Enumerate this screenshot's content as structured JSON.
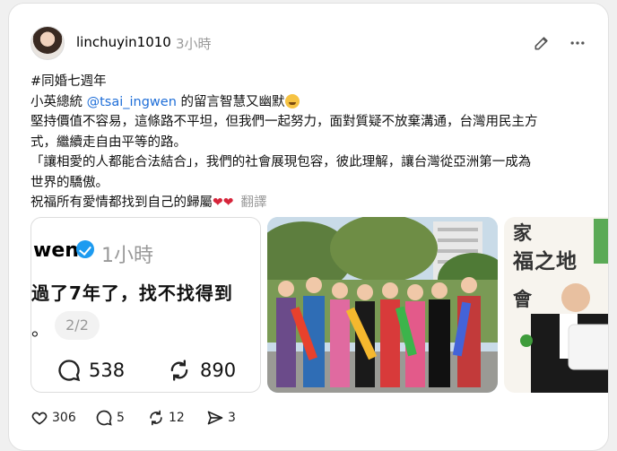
{
  "post": {
    "username": "linchuyin1010",
    "timestamp": "3小時",
    "hashtag": "#同婚七週年",
    "line2_pre": "小英總統 ",
    "mention": "@tsai_ingwen",
    "line2_post": " 的留言智慧又幽默",
    "line3": "堅持價值不容易，這條路不平坦，但我們一起努力，面對質疑不放棄溝通，台灣用民主方",
    "line4": "式，繼續走自由平等的路。",
    "line5": "「讓相愛的人都能合法結合」，我們的社會展現包容，彼此理解，讓台灣從亞洲第一成為",
    "line6": "世界的驕傲。",
    "line7": "祝福所有愛情都找到自己的歸屬",
    "translate": "翻譯"
  },
  "quote": {
    "name": "wen",
    "time": "1小時",
    "text": "過了7年了，找不找得到",
    "dot": "。",
    "page": "2/2",
    "replies": "538",
    "reposts": "890"
  },
  "photo3": {
    "line1": "家",
    "line2": "福之地",
    "line3": "會"
  },
  "actions": {
    "likes": "306",
    "comments": "5",
    "reposts": "12",
    "shares": "3"
  }
}
